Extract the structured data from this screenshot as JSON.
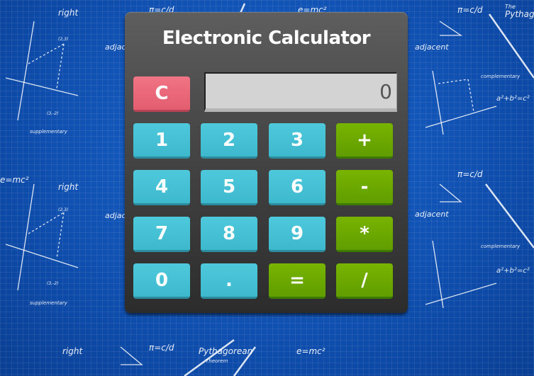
{
  "title": "Electronic Calculator",
  "display": {
    "value": "0"
  },
  "buttons": {
    "clear": "C",
    "one": "1",
    "two": "2",
    "three": "3",
    "plus": "+",
    "four": "4",
    "five": "5",
    "six": "6",
    "minus": "-",
    "seven": "7",
    "eight": "8",
    "nine": "9",
    "multiply": "*",
    "zero": "0",
    "decimal": ".",
    "equals": "=",
    "divide": "/"
  },
  "background_text": {
    "right": "right",
    "adjacent": "adjacent",
    "supplementary": "supplementary",
    "complementary": "complementary",
    "pythagorean_the": "The",
    "pythagorean_main": "Pythagorean",
    "pythagorean_theorem": "Theorem",
    "einstein": "e=mc²",
    "pi_formula": "π=c/d",
    "abc_formula": "a²+b²=c²",
    "point_a": "(2,3)",
    "point_b": "(3,-2)"
  },
  "colors": {
    "background": "#0f53b8",
    "number_button": "#45c0d4",
    "operator_button": "#6aa800",
    "clear_button": "#e96879",
    "display_bg": "#d3d3d3",
    "body": "#4a4a4a"
  }
}
